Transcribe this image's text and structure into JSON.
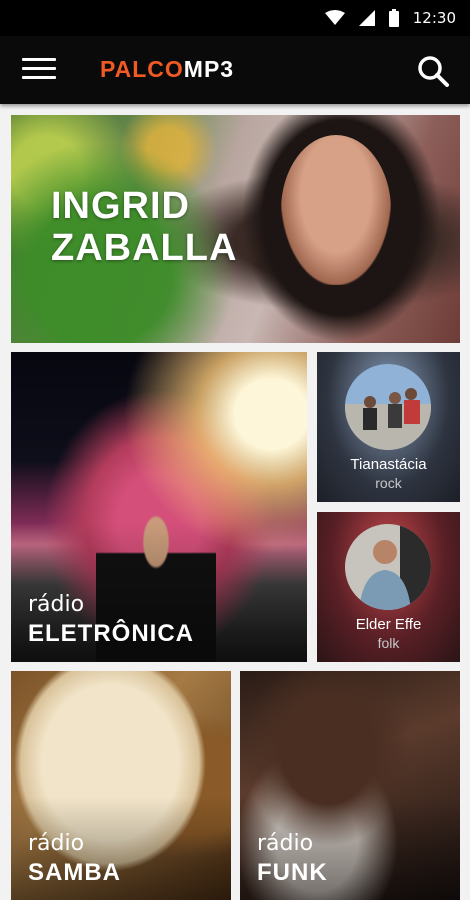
{
  "status_bar": {
    "time": "12:30"
  },
  "app_bar": {
    "logo_part1": "PALCO",
    "logo_part2": "MP3"
  },
  "hero": {
    "line1": "INGRID",
    "line2": "ZABALLA"
  },
  "radio_eletronica": {
    "prefix": "rádio",
    "name": "ELETRÔNICA"
  },
  "artists": [
    {
      "name": "Tianastácia",
      "genre": "rock"
    },
    {
      "name": "Elder Effe",
      "genre": "folk"
    }
  ],
  "radio_samba": {
    "prefix": "rádio",
    "name": "SAMBA"
  },
  "radio_funk": {
    "prefix": "rádio",
    "name": "FUNK"
  },
  "colors": {
    "logo_accent": "#f15a24",
    "bar_bg": "#0a0a0a",
    "page_bg": "#f2f2f2"
  }
}
